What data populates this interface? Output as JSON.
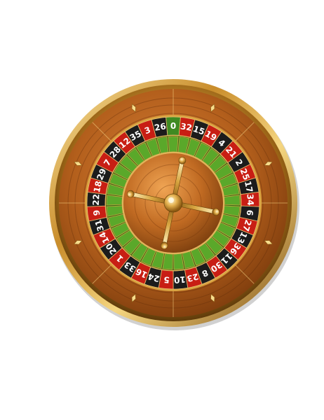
{
  "wheel": {
    "pockets": [
      {
        "number": "0",
        "color": "green"
      },
      {
        "number": "32",
        "color": "red"
      },
      {
        "number": "15",
        "color": "black"
      },
      {
        "number": "19",
        "color": "red"
      },
      {
        "number": "4",
        "color": "black"
      },
      {
        "number": "21",
        "color": "red"
      },
      {
        "number": "2",
        "color": "black"
      },
      {
        "number": "25",
        "color": "red"
      },
      {
        "number": "17",
        "color": "black"
      },
      {
        "number": "34",
        "color": "red"
      },
      {
        "number": "6",
        "color": "black"
      },
      {
        "number": "27",
        "color": "red"
      },
      {
        "number": "13",
        "color": "black"
      },
      {
        "number": "36",
        "color": "red"
      },
      {
        "number": "11",
        "color": "black"
      },
      {
        "number": "30",
        "color": "red"
      },
      {
        "number": "8",
        "color": "black"
      },
      {
        "number": "23",
        "color": "red"
      },
      {
        "number": "10",
        "color": "black"
      },
      {
        "number": "5",
        "color": "red"
      },
      {
        "number": "24",
        "color": "black"
      },
      {
        "number": "16",
        "color": "red"
      },
      {
        "number": "33",
        "color": "black"
      },
      {
        "number": "1",
        "color": "red"
      },
      {
        "number": "20",
        "color": "black"
      },
      {
        "number": "14",
        "color": "red"
      },
      {
        "number": "31",
        "color": "black"
      },
      {
        "number": "9",
        "color": "red"
      },
      {
        "number": "22",
        "color": "black"
      },
      {
        "number": "18",
        "color": "red"
      },
      {
        "number": "29",
        "color": "black"
      },
      {
        "number": "7",
        "color": "red"
      },
      {
        "number": "28",
        "color": "black"
      },
      {
        "number": "12",
        "color": "red"
      },
      {
        "number": "35",
        "color": "black"
      },
      {
        "number": "3",
        "color": "red"
      },
      {
        "number": "26",
        "color": "black"
      }
    ],
    "colors": {
      "red": "#c81e14",
      "black": "#1c1c1c",
      "green": "#3f8a22",
      "gold": "#d9a441",
      "gold_light": "#f7dc8c",
      "gold_dark": "#8a5a14",
      "wood": "#b8621c",
      "wood_dark": "#7a3a0c",
      "felt_green": "#5aa82a",
      "white_text": "#ffffff"
    },
    "icons": {
      "hub": "turret-handle-icon",
      "diamonds": "diamond-deflector-icon"
    }
  }
}
